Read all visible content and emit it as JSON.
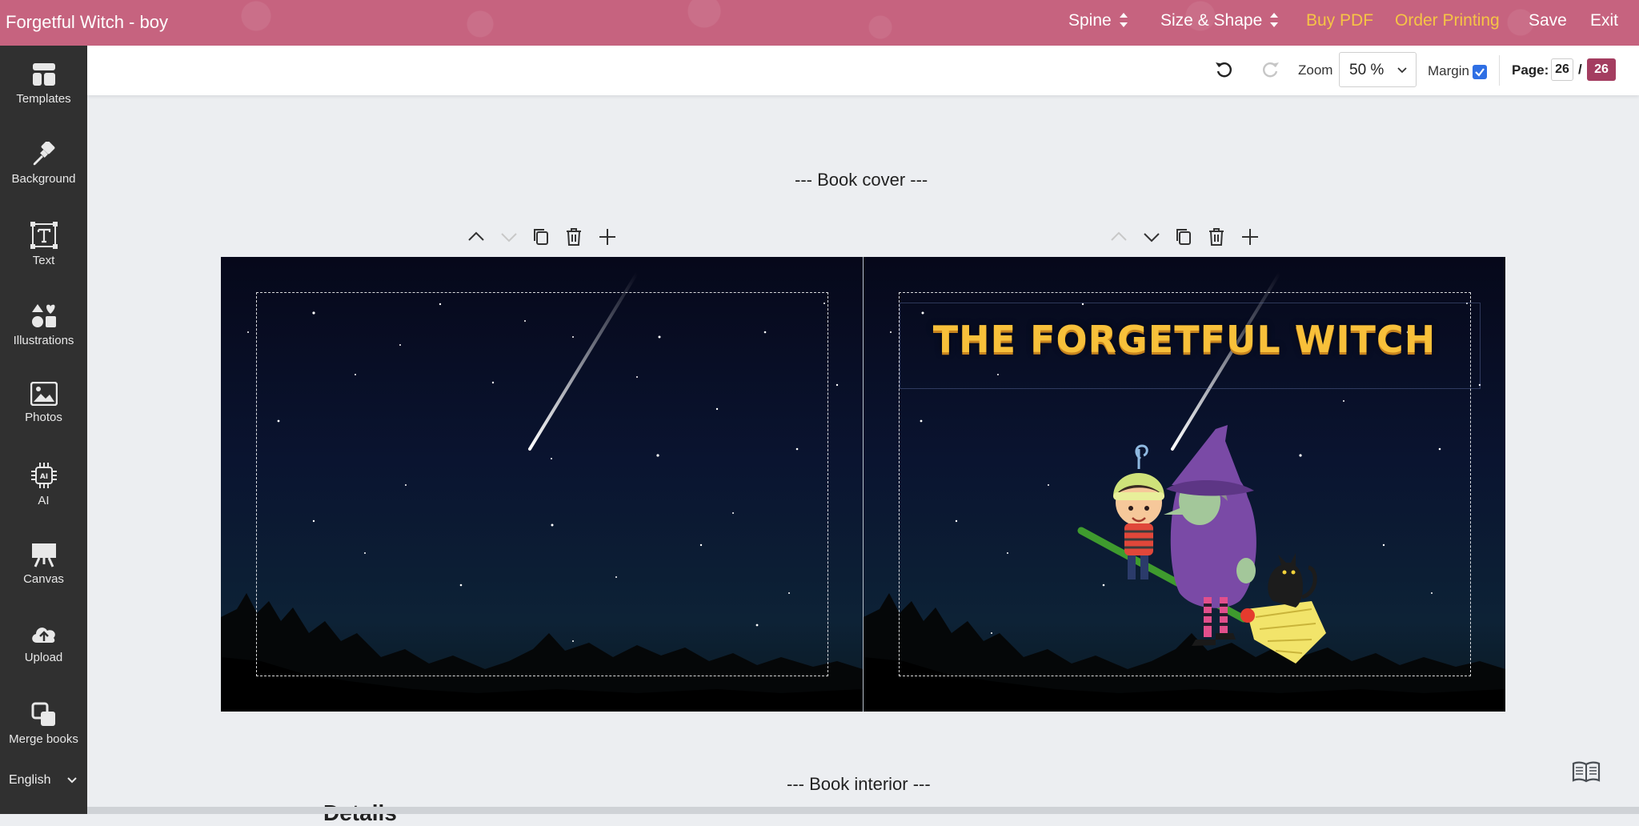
{
  "app": {
    "title": "Forgetful Witch - boy"
  },
  "topnav": {
    "spine": "Spine",
    "size_shape": "Size & Shape",
    "buy_pdf": "Buy PDF",
    "order_printing": "Order Printing",
    "save": "Save",
    "exit": "Exit",
    "accent_color": "#f6c445",
    "bar_color": "#c6637f"
  },
  "sidebar": {
    "items": [
      {
        "label": "Templates",
        "icon": "templates-icon"
      },
      {
        "label": "Background",
        "icon": "paintbrush-icon"
      },
      {
        "label": "Text",
        "icon": "text-icon"
      },
      {
        "label": "Illustrations",
        "icon": "shapes-icon"
      },
      {
        "label": "Photos",
        "icon": "image-icon"
      },
      {
        "label": "AI",
        "icon": "ai-chip-icon"
      },
      {
        "label": "Canvas",
        "icon": "easel-icon"
      },
      {
        "label": "Upload",
        "icon": "cloud-upload-icon"
      },
      {
        "label": "Merge books",
        "icon": "merge-icon"
      }
    ],
    "language": "English"
  },
  "toolbar": {
    "zoom_label": "Zoom",
    "zoom_value": "50 %",
    "margin_label": "Margin",
    "margin_checked": true,
    "page_label": "Page:",
    "page_current": "26",
    "page_separator": "/",
    "page_total": "26",
    "page_total_color": "#a43d60"
  },
  "canvas": {
    "cover_heading": "--- Book cover ---",
    "interior_heading": "--- Book interior ---",
    "cover_title": "THE FORGETFUL WITCH",
    "cover_title_color": "#f8c03a",
    "details_peek": "Details"
  }
}
